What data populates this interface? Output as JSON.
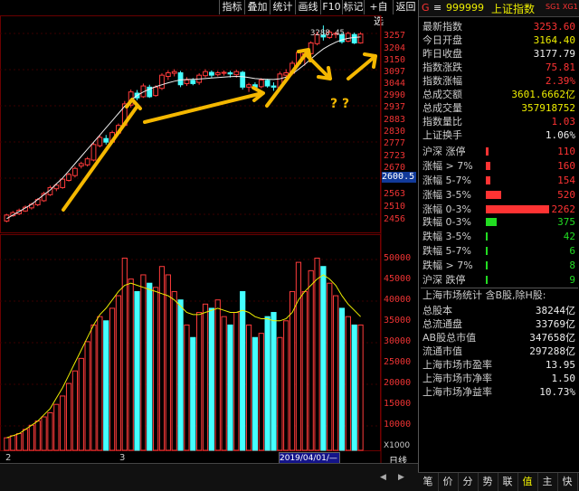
{
  "toolbar": {
    "buttons": [
      "指标",
      "叠加",
      "统计",
      "画线",
      "F10",
      "标记",
      "+自选",
      "返回"
    ]
  },
  "price_axis": [
    "3257",
    "3204",
    "3150",
    "3097",
    "3044",
    "2990",
    "2937",
    "2883",
    "2830",
    "2777",
    "2723",
    "2670",
    "2563",
    "2510",
    "2456"
  ],
  "current_price": "2600.5",
  "volume_axis": [
    "50000",
    "45000",
    "40000",
    "35000",
    "30000",
    "25000",
    "20000",
    "15000",
    "10000"
  ],
  "volume_unit": "X1000",
  "annotations": {
    "peak_label": "3288.45",
    "question_marks": "? ?"
  },
  "time_axis": {
    "labels": [
      "2",
      "3"
    ],
    "date_box": "2019/04/01/—",
    "period": "日线"
  },
  "bottom_tabs": [
    "◀",
    "▶"
  ],
  "chart_data": {
    "type": "candlestick",
    "y_range": [
      2430,
      3300
    ],
    "candles": [
      [
        2470,
        2495,
        2465,
        2500
      ],
      [
        2492,
        2505,
        2488,
        2512
      ],
      [
        2500,
        2515,
        2495,
        2522
      ],
      [
        2512,
        2528,
        2508,
        2535
      ],
      [
        2525,
        2540,
        2518,
        2546
      ],
      [
        2538,
        2560,
        2532,
        2566
      ],
      [
        2555,
        2585,
        2550,
        2592
      ],
      [
        2580,
        2610,
        2575,
        2618
      ],
      [
        2605,
        2620,
        2595,
        2628
      ],
      [
        2610,
        2645,
        2605,
        2650
      ],
      [
        2640,
        2665,
        2635,
        2672
      ],
      [
        2660,
        2690,
        2652,
        2698
      ],
      [
        2700,
        2710,
        2690,
        2718
      ],
      [
        2705,
        2730,
        2698,
        2738
      ],
      [
        2725,
        2790,
        2720,
        2798
      ],
      [
        2785,
        2820,
        2778,
        2828
      ],
      [
        2815,
        2800,
        2790,
        2830
      ],
      [
        2800,
        2840,
        2795,
        2848
      ],
      [
        2838,
        2870,
        2830,
        2878
      ],
      [
        2870,
        2960,
        2865,
        2972
      ],
      [
        2955,
        3010,
        2945,
        3020
      ],
      [
        3005,
        2985,
        2975,
        3018
      ],
      [
        2990,
        3035,
        2985,
        3045
      ],
      [
        3030,
        2990,
        2985,
        3040
      ],
      [
        2995,
        3030,
        2990,
        3038
      ],
      [
        3025,
        3080,
        3018,
        3088
      ],
      [
        3075,
        3090,
        3060,
        3100
      ],
      [
        3088,
        3095,
        3075,
        3105
      ],
      [
        3090,
        3040,
        3030,
        3098
      ],
      [
        3045,
        3060,
        3035,
        3072
      ],
      [
        3058,
        3045,
        3038,
        3068
      ],
      [
        3050,
        3080,
        3040,
        3088
      ],
      [
        3078,
        3095,
        3070,
        3105
      ],
      [
        3092,
        3080,
        3070,
        3100
      ],
      [
        3082,
        3090,
        3075,
        3098
      ],
      [
        3088,
        3092,
        3078,
        3100
      ],
      [
        3090,
        3085,
        3070,
        3098
      ],
      [
        3082,
        3095,
        3070,
        3102
      ],
      [
        3092,
        3030,
        3020,
        3098
      ],
      [
        3030,
        3040,
        3010,
        3048
      ],
      [
        3040,
        3030,
        3020,
        3050
      ],
      [
        3032,
        3060,
        3025,
        3068
      ],
      [
        3058,
        3035,
        3028,
        3065
      ],
      [
        3035,
        3030,
        3015,
        3050
      ],
      [
        3028,
        3085,
        3020,
        3095
      ],
      [
        3080,
        3090,
        3070,
        3105
      ],
      [
        3088,
        3130,
        3080,
        3140
      ],
      [
        3128,
        3175,
        3120,
        3182
      ],
      [
        3170,
        3170,
        3120,
        3180
      ],
      [
        3170,
        3215,
        3165,
        3222
      ],
      [
        3212,
        3250,
        3205,
        3262
      ],
      [
        3248,
        3240,
        3225,
        3288
      ],
      [
        3238,
        3260,
        3232,
        3268
      ],
      [
        3255,
        3255,
        3235,
        3262
      ],
      [
        3250,
        3220,
        3212,
        3258
      ],
      [
        3222,
        3255,
        3218,
        3262
      ],
      [
        3250,
        3215,
        3210,
        3258
      ],
      [
        3215,
        3252,
        3212,
        3260
      ]
    ],
    "volume_y_range": [
      6000,
      56000
    ],
    "volume": [
      9000,
      9500,
      10000,
      11000,
      12000,
      13000,
      14000,
      15000,
      17000,
      19000,
      22000,
      25000,
      28000,
      32000,
      36000,
      38000,
      37000,
      40000,
      43000,
      52000,
      47000,
      44000,
      48000,
      46000,
      45000,
      50000,
      48000,
      44000,
      42000,
      36000,
      33000,
      39000,
      41000,
      40000,
      42000,
      38000,
      36000,
      39000,
      44000,
      36000,
      33000,
      34000,
      38000,
      39000,
      33000,
      37000,
      44000,
      51000,
      44000,
      49000,
      52000,
      50000,
      46000,
      43000,
      40000,
      38000,
      36000,
      36000
    ],
    "ma_price": [
      2480,
      2495,
      2510,
      2525,
      2540,
      2560,
      2580,
      2600,
      2625,
      2650,
      2680,
      2710,
      2740,
      2770,
      2800,
      2830,
      2860,
      2890,
      2920,
      2950,
      2975,
      2995,
      3010,
      3022,
      3032,
      3040,
      3048,
      3055,
      3060,
      3062,
      3063,
      3064,
      3066,
      3068,
      3070,
      3072,
      3074,
      3075,
      3074,
      3070,
      3066,
      3064,
      3063,
      3062,
      3065,
      3072,
      3085,
      3105,
      3125,
      3148,
      3170,
      3190,
      3205,
      3218,
      3228,
      3234,
      3238,
      3240
    ],
    "ma_volume_fast": [
      9000,
      9500,
      10000,
      11000,
      12000,
      13000,
      14500,
      16000,
      18500,
      21000,
      24000,
      27000,
      30000,
      33000,
      36000,
      38500,
      40000,
      42000,
      44000,
      45500,
      46000,
      45500,
      45000,
      44500,
      44000,
      43500,
      43000,
      42000,
      40500,
      39000,
      38500,
      38500,
      39000,
      39500,
      40000,
      39500,
      39000,
      39000,
      39500,
      39000,
      38000,
      37500,
      37500,
      37000,
      37000,
      37500,
      39000,
      42000,
      44000,
      45500,
      47000,
      48000,
      47000,
      45500,
      43000,
      41000,
      39500,
      38000
    ]
  },
  "sidebar": {
    "header": {
      "code": "999999",
      "name": "上证指数",
      "tag": "SG1 XG1",
      "prefix": "G",
      "menu": "≡"
    },
    "quote": [
      {
        "k": "最新指数",
        "v": "3253.60",
        "c": "red"
      },
      {
        "k": "今日开盘",
        "v": "3164.40",
        "c": "yel"
      },
      {
        "k": "昨日收盘",
        "v": "3177.79",
        "c": "wht"
      },
      {
        "k": "指数涨跌",
        "v": "75.81",
        "c": "red"
      },
      {
        "k": "指数涨幅",
        "v": "2.39%",
        "c": "red"
      },
      {
        "k": "总成交额",
        "v": "3601.6662亿",
        "c": "yel"
      },
      {
        "k": "总成交量",
        "v": "357918752",
        "c": "yel"
      },
      {
        "k": "指数量比",
        "v": "1.03",
        "c": "red"
      },
      {
        "k": "上证换手",
        "v": "1.06%",
        "c": "wht"
      }
    ],
    "up_dist": [
      {
        "k": "沪深 涨停",
        "v": "110",
        "pct": 0.03
      },
      {
        "k": "涨幅 > 7%",
        "v": "160",
        "pct": 0.05
      },
      {
        "k": "涨幅 5-7%",
        "v": "154",
        "pct": 0.05
      },
      {
        "k": "涨幅 3-5%",
        "v": "520",
        "pct": 0.18
      },
      {
        "k": "涨幅 0-3%",
        "v": "2262",
        "pct": 0.76
      }
    ],
    "down_dist": [
      {
        "k": "跌幅 0-3%",
        "v": "375",
        "pct": 0.13
      },
      {
        "k": "跌幅 3-5%",
        "v": "42",
        "pct": 0.015
      },
      {
        "k": "跌幅 5-7%",
        "v": "6",
        "pct": 0.004
      },
      {
        "k": "跌幅 > 7%",
        "v": "8",
        "pct": 0.004
      },
      {
        "k": "沪深 跌停",
        "v": "9",
        "pct": 0.004
      }
    ],
    "market_title": "上海市场统计 含B股,除H股:",
    "market": [
      {
        "k": "总股本",
        "v": "38244亿"
      },
      {
        "k": "总流通盘",
        "v": "33769亿"
      },
      {
        "k": "AB股总市值",
        "v": "347658亿"
      },
      {
        "k": "流通市值",
        "v": "297288亿"
      },
      {
        "k": "上海市场市盈率",
        "v": "13.95"
      },
      {
        "k": "上海市场市净率",
        "v": "1.50"
      },
      {
        "k": "上海市场净益率",
        "v": "10.73%"
      }
    ],
    "tabs": [
      "笔",
      "价",
      "分",
      "势",
      "联",
      "值",
      "主",
      "快"
    ]
  }
}
